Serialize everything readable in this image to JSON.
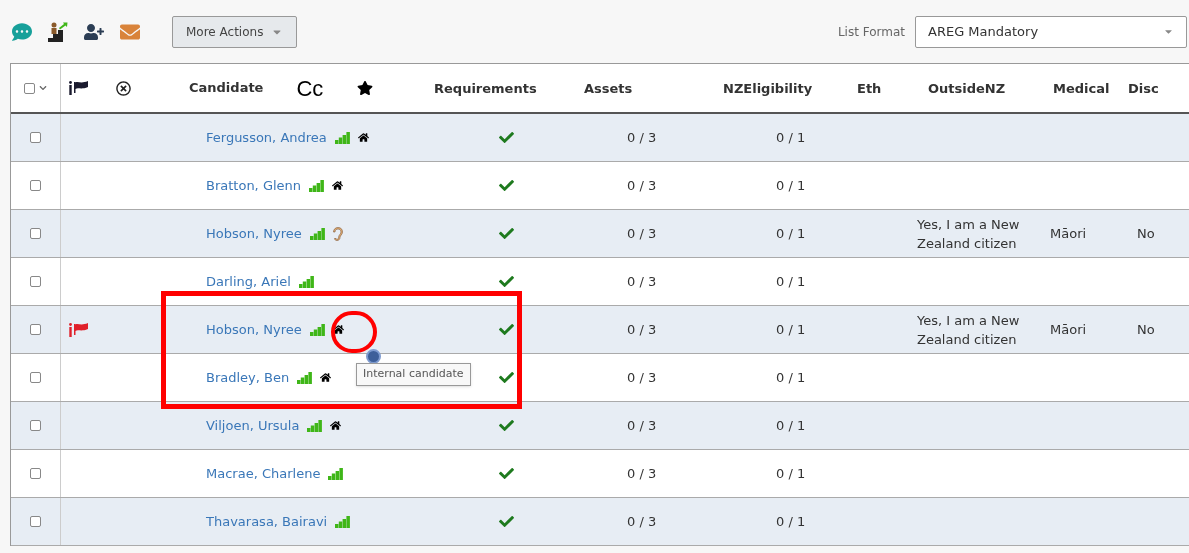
{
  "toolbar": {
    "more_actions": "More Actions",
    "list_format_label": "List Format",
    "list_format_value": "AREG Mandatory"
  },
  "table": {
    "select_all": {
      "checked": false
    },
    "columns": [
      "Candidate",
      "Cc",
      "Requirements",
      "Assets",
      "NZEligibility",
      "Eth",
      "OutsideNZ",
      "Medical",
      "Disc"
    ],
    "rows": [
      {
        "checked": false,
        "flagged": false,
        "name": "Fergusson, Andrea",
        "internal": true,
        "hearing": false,
        "requirements_met": true,
        "assets": "0 / 3",
        "eligibility": "0 / 1"
      },
      {
        "checked": false,
        "flagged": false,
        "name": "Bratton, Glenn",
        "internal": true,
        "hearing": false,
        "requirements_met": true,
        "assets": "0 / 3",
        "eligibility": "0 / 1"
      },
      {
        "checked": false,
        "flagged": false,
        "name": "Hobson, Nyree",
        "internal": false,
        "hearing": true,
        "requirements_met": true,
        "assets": "0 / 3",
        "eligibility": "0 / 1",
        "outside_nz": "Yes, I am a New Zealand citizen",
        "medical": "Māori",
        "disc": "No"
      },
      {
        "checked": false,
        "flagged": false,
        "name": "Darling, Ariel",
        "internal": false,
        "hearing": false,
        "requirements_met": true,
        "assets": "0 / 3",
        "eligibility": "0 / 1"
      },
      {
        "checked": false,
        "flagged": true,
        "name": "Hobson, Nyree",
        "internal": true,
        "hearing": false,
        "requirements_met": true,
        "assets": "0 / 3",
        "eligibility": "0 / 1",
        "outside_nz": "Yes, I am a New Zealand citizen",
        "medical": "Māori",
        "disc": "No",
        "tooltip": "Internal candidate"
      },
      {
        "checked": false,
        "flagged": false,
        "name": "Bradley, Ben",
        "internal": true,
        "hearing": false,
        "requirements_met": true,
        "assets": "0 / 3",
        "eligibility": "0 / 1"
      },
      {
        "checked": false,
        "flagged": false,
        "name": "Viljoen, Ursula",
        "internal": true,
        "hearing": false,
        "requirements_met": true,
        "assets": "0 / 3",
        "eligibility": "0 / 1"
      },
      {
        "checked": false,
        "flagged": false,
        "name": "Macrae, Charlene",
        "internal": false,
        "hearing": false,
        "requirements_met": true,
        "assets": "0 / 3",
        "eligibility": "0 / 1"
      },
      {
        "checked": false,
        "flagged": false,
        "name": "Thavarasa, Bairavi",
        "internal": false,
        "hearing": false,
        "requirements_met": true,
        "assets": "0 / 3",
        "eligibility": "0 / 1"
      }
    ]
  }
}
